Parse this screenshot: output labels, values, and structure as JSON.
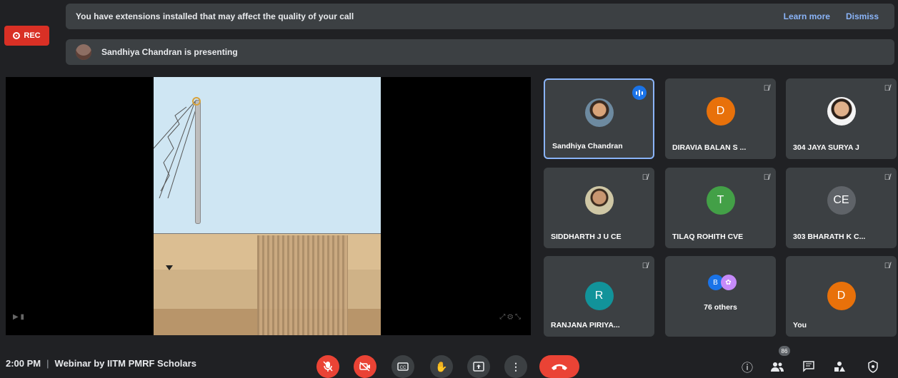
{
  "extension_banner": {
    "message": "You have extensions installed that may affect the quality of your call",
    "learn_more": "Learn more",
    "dismiss": "Dismiss"
  },
  "recording": {
    "label": "REC",
    "color": "#d93025"
  },
  "presenting_banner": {
    "message": "Sandhiya Chandran is presenting"
  },
  "participants": [
    {
      "name": "Sandhiya Chandran",
      "avatar": "photo",
      "speaking": true
    },
    {
      "name": "DIRAVIA BALAN S ...",
      "initial": "D",
      "color": "#e8710a",
      "muted": true
    },
    {
      "name": "304 JAYA SURYA J",
      "avatar": "photo",
      "muted": true
    },
    {
      "name": "SIDDHARTH J U CE",
      "avatar": "photo",
      "muted": true
    },
    {
      "name": "TILAQ ROHITH CVE",
      "initial": "T",
      "color": "#43a047",
      "muted": true
    },
    {
      "name": "303 BHARATH K C...",
      "initial": "CE",
      "color": "#5f6368",
      "muted": true
    },
    {
      "name": "RANJANA PIRIYA...",
      "initial": "R",
      "color": "#12939a",
      "muted": true
    },
    {
      "others_label": "76 others",
      "others_initial": "B"
    },
    {
      "name": "You",
      "initial": "D",
      "color": "#e8710a",
      "muted": true
    }
  ],
  "bottom_bar": {
    "time": "2:00 PM",
    "separator": "|",
    "meeting_title": "Webinar by IITM PMRF Scholars",
    "people_count": "86",
    "accent_red": "#ea4335"
  }
}
